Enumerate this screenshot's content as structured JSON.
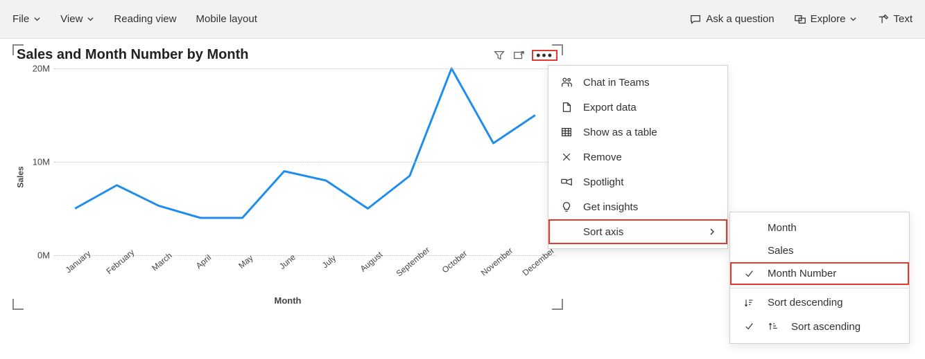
{
  "toolbar": {
    "file": "File",
    "view": "View",
    "reading_view": "Reading view",
    "mobile_layout": "Mobile layout",
    "ask": "Ask a question",
    "explore": "Explore",
    "text": "Text"
  },
  "visual": {
    "title": "Sales and Month Number by Month",
    "y_label": "Sales",
    "x_label": "Month"
  },
  "menu1": {
    "chat": "Chat in Teams",
    "export": "Export data",
    "table": "Show as a table",
    "remove": "Remove",
    "spotlight": "Spotlight",
    "insights": "Get insights",
    "sort_axis": "Sort axis"
  },
  "menu2": {
    "month": "Month",
    "sales": "Sales",
    "month_number": "Month Number",
    "sort_desc": "Sort descending",
    "sort_asc": "Sort ascending"
  },
  "chart_data": {
    "type": "line",
    "title": "Sales and Month Number by Month",
    "xlabel": "Month",
    "ylabel": "Sales",
    "ylim": [
      0,
      20
    ],
    "y_ticks": [
      0,
      10,
      20
    ],
    "y_tick_labels": [
      "0M",
      "10M",
      "20M"
    ],
    "categories": [
      "January",
      "February",
      "March",
      "April",
      "May",
      "June",
      "July",
      "August",
      "September",
      "October",
      "November",
      "December"
    ],
    "values": [
      5,
      7.5,
      5.3,
      4,
      4,
      9,
      8,
      5,
      8.5,
      20,
      12,
      15
    ]
  }
}
